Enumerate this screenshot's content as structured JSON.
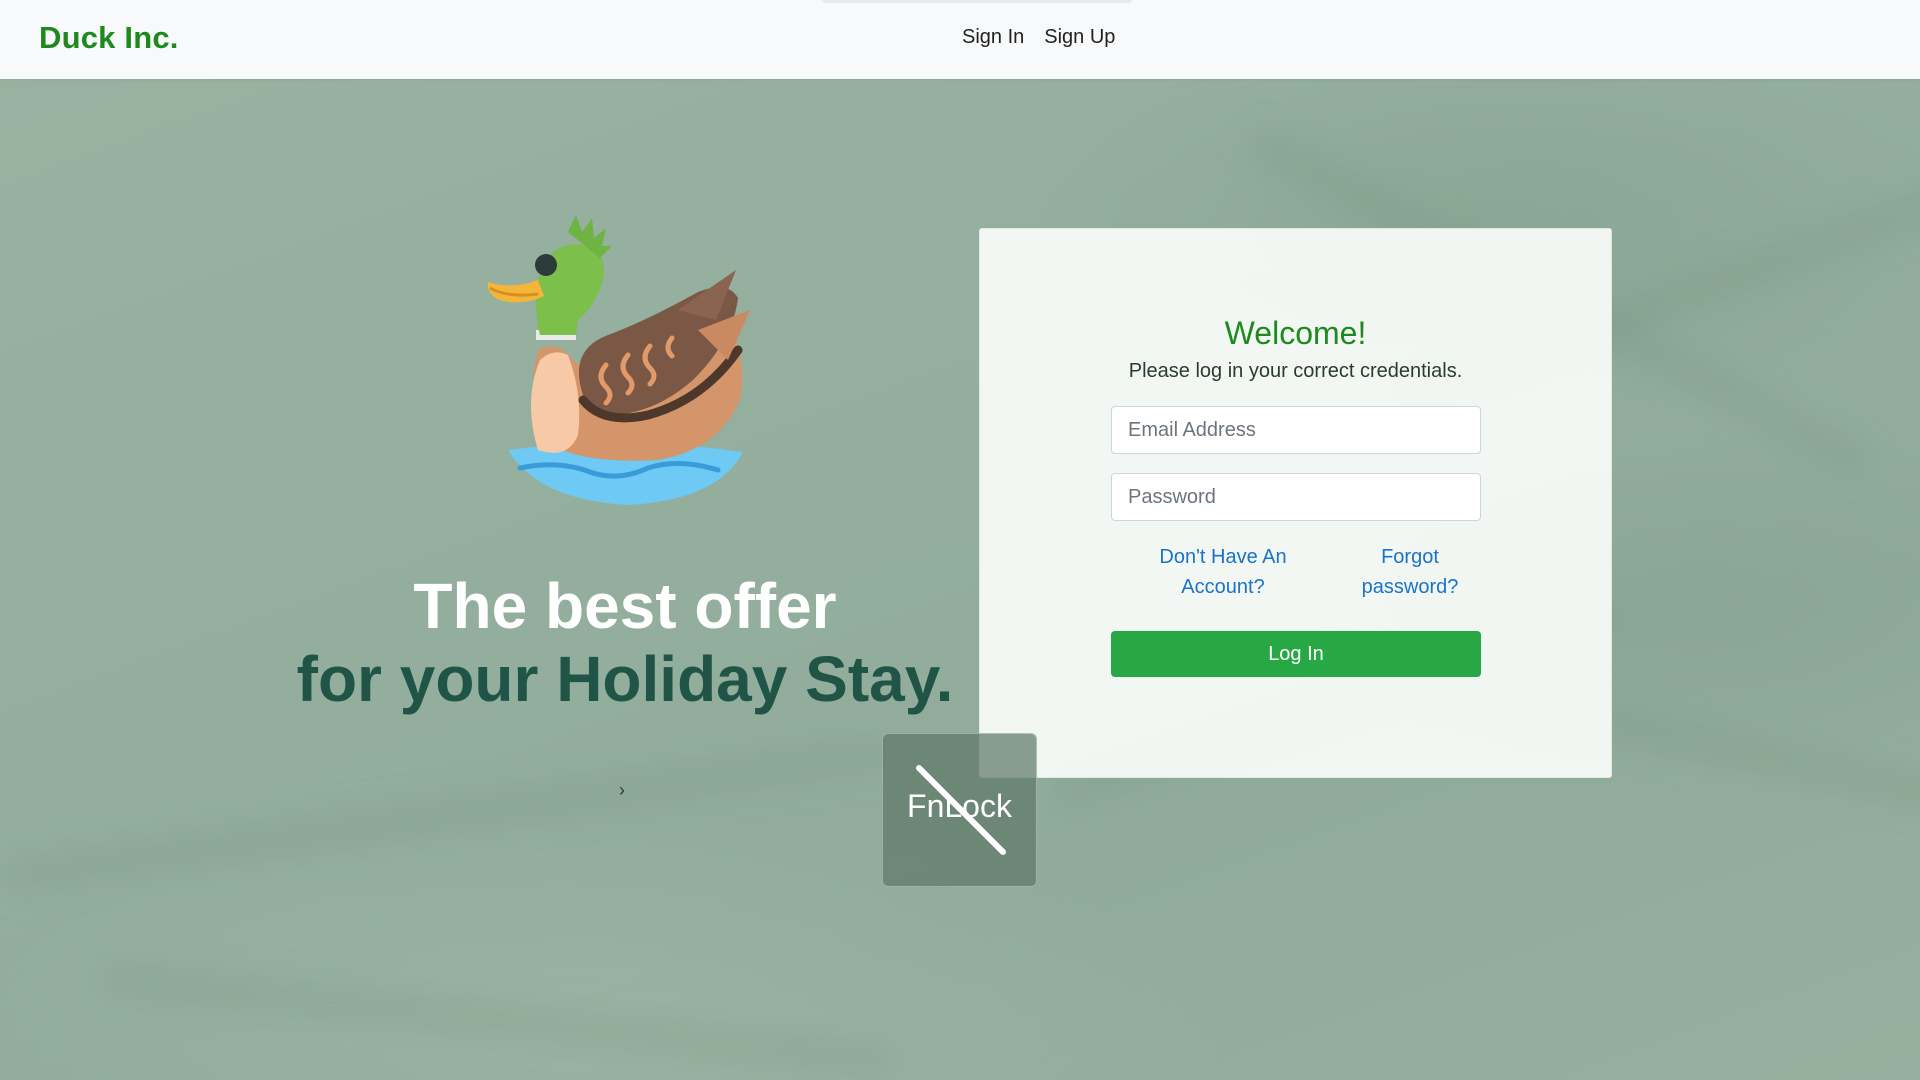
{
  "navbar": {
    "brand": "Duck Inc.",
    "links": [
      {
        "label": "Sign In"
      },
      {
        "label": "Sign Up"
      }
    ]
  },
  "hero": {
    "line1": "The best offer",
    "line2": "for your Holiday Stay.",
    "next_glyph": "›"
  },
  "login": {
    "title": "Welcome!",
    "subtitle": "Please log in your correct credentials.",
    "email": {
      "placeholder": "Email Address",
      "value": ""
    },
    "password": {
      "placeholder": "Password",
      "value": ""
    },
    "signup_link": "Don't Have An Account?",
    "forgot_link": "Forgot password?",
    "submit_label": "Log In"
  },
  "overlay": {
    "label": "FnLock",
    "icon": "fnlock-disabled-icon"
  },
  "colors": {
    "brand": "#1e8a1e",
    "primary_button": "#28a745",
    "link": "#1a73c9",
    "hero_secondary": "#1f5447",
    "background": "#93ae9d"
  }
}
